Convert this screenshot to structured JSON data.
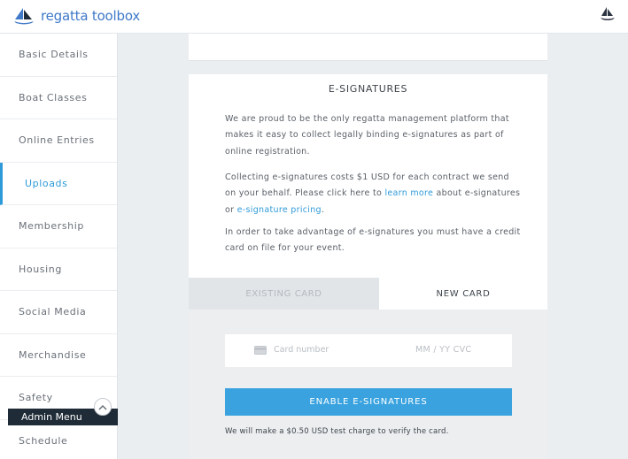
{
  "header": {
    "brand_text": "regatta toolbox",
    "brand_color": "#3f79c8"
  },
  "sidebar": {
    "items": [
      {
        "label": "Basic Details"
      },
      {
        "label": "Boat Classes"
      },
      {
        "label": "Online Entries"
      },
      {
        "label": "Uploads",
        "active": true
      },
      {
        "label": "Membership"
      },
      {
        "label": "Housing"
      },
      {
        "label": "Social Media"
      },
      {
        "label": "Merchandise"
      },
      {
        "label": "Safety"
      },
      {
        "label": "Schedule"
      }
    ],
    "admin_menu_label": "Admin Menu",
    "admin_toggle_icon": "chevron-up-icon"
  },
  "esign": {
    "title": "E-SIGNATURES",
    "para1": "We are proud to be the only regatta management platform that makes it easy to collect legally binding e-signatures as part of online registration.",
    "para2_prefix": "Collecting e-signatures costs $1 USD for each contract we send on your behalf. Please click here to ",
    "learn_more": "learn more",
    "para2_middle": " about e-signatures or ",
    "pricing_link": "e-signature pricing",
    "para2_suffix": ".",
    "para3": "In order to take advantage of e-signatures you must have a credit card on file for your event.",
    "tab_existing": "EXISTING CARD",
    "tab_new": "NEW CARD",
    "card_placeholder": "Card number",
    "exp_placeholder": "MM / YY  CVC",
    "enable_button": "ENABLE E-SIGNATURES",
    "test_charge_note": "We will make a $0.50 USD test charge to verify the card."
  },
  "colors": {
    "accent": "#2f9ad8",
    "button": "#3aa3df",
    "admin_bar": "#1f2b36"
  }
}
